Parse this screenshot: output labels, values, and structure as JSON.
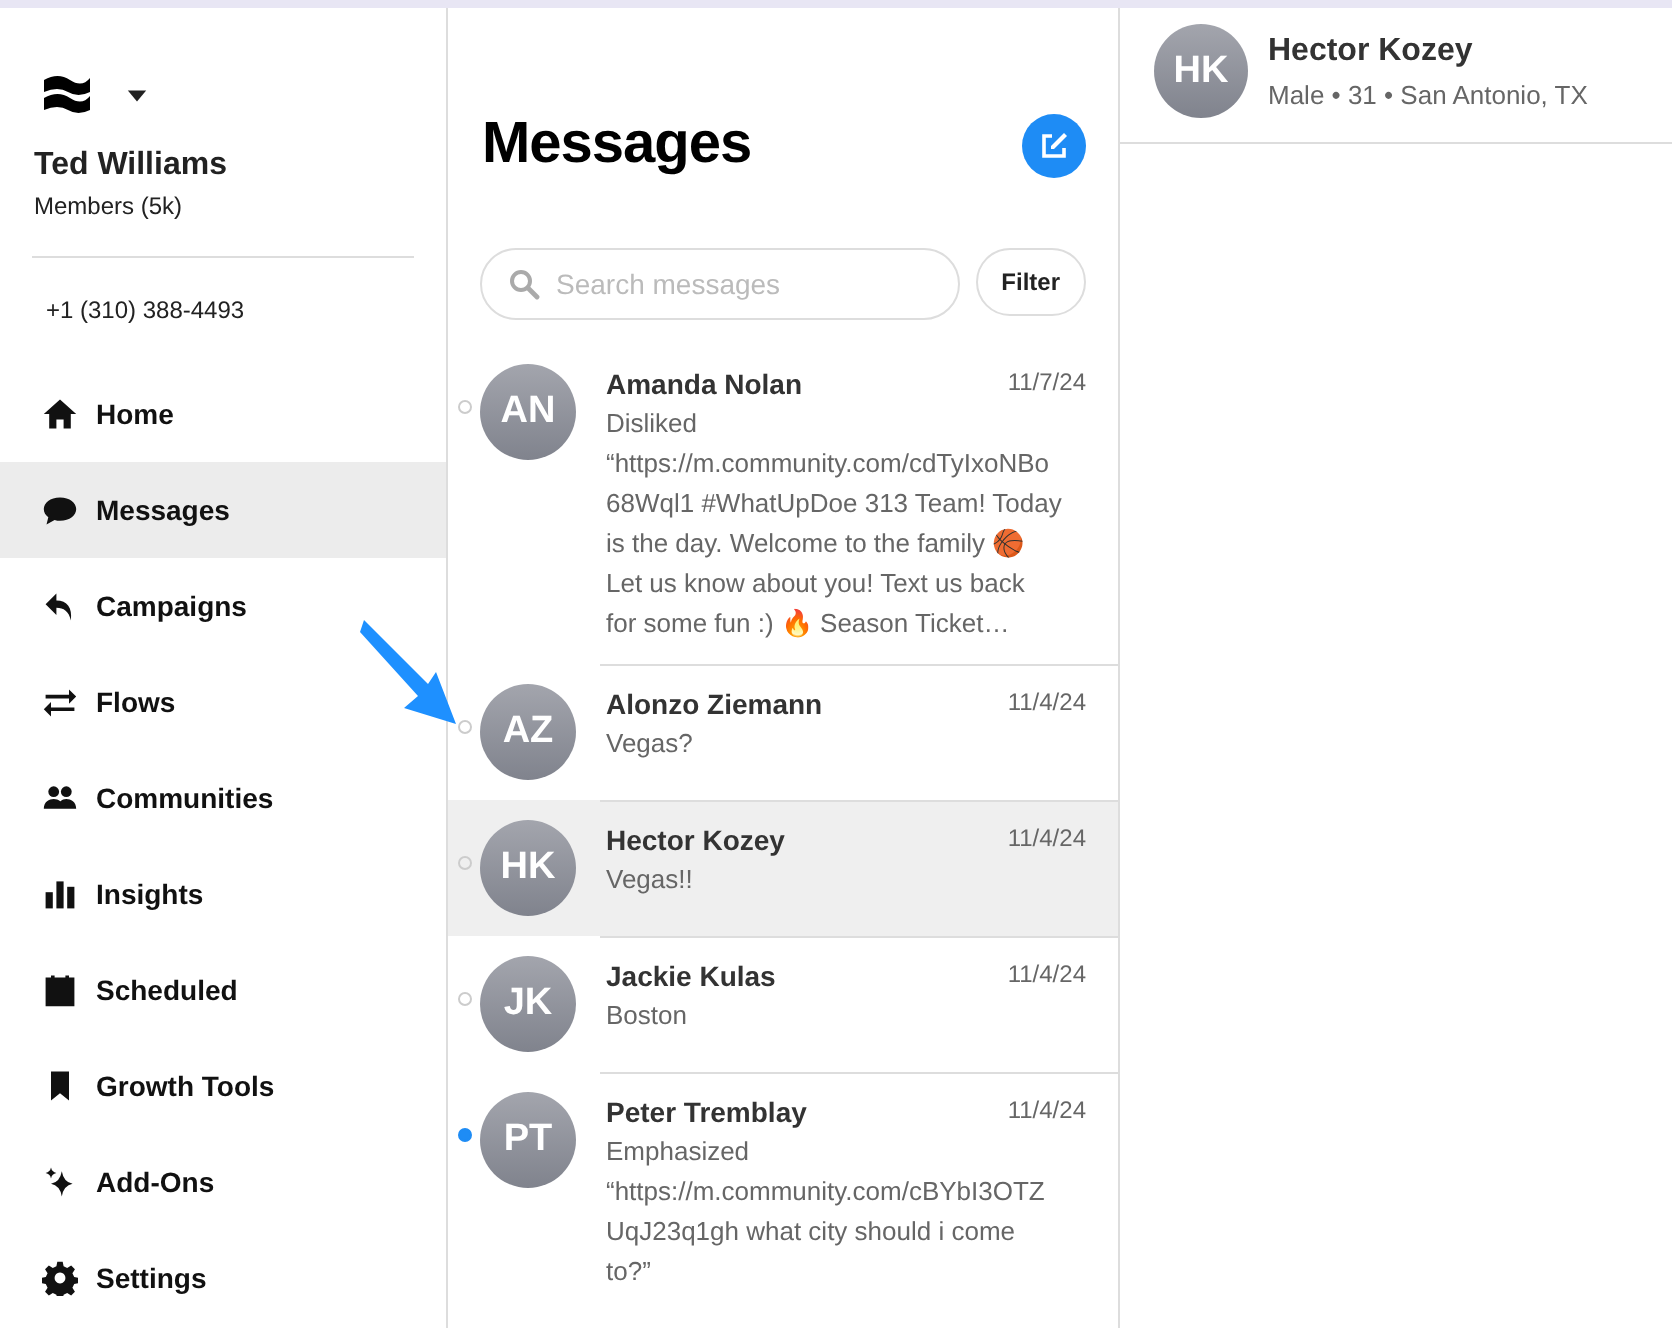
{
  "account": {
    "name": "Ted Williams",
    "members": "Members (5k)",
    "phone": "+1 (310) 388-4493"
  },
  "nav": [
    {
      "label": "Home",
      "selected": false
    },
    {
      "label": "Messages",
      "selected": true
    },
    {
      "label": "Campaigns",
      "selected": false
    },
    {
      "label": "Flows",
      "selected": false
    },
    {
      "label": "Communities",
      "selected": false
    },
    {
      "label": "Insights",
      "selected": false
    },
    {
      "label": "Scheduled",
      "selected": false
    },
    {
      "label": "Growth Tools",
      "selected": false
    },
    {
      "label": "Add-Ons",
      "selected": false
    },
    {
      "label": "Settings",
      "selected": false
    }
  ],
  "messages_panel": {
    "title": "Messages",
    "search": {
      "placeholder": "Search messages"
    },
    "filter": "Filter",
    "conversations": [
      {
        "initials": "AN",
        "name": "Amanda Nolan",
        "date": "11/7/24",
        "preview": "Disliked “https://m.community.com/cdTyIxoNBo68Wql1 #WhatUpDoe 313 Team! Today is the day. Welcome to the family 🏀 Let us know about you! Text us back for some fun :) 🔥 Season Ticket…",
        "unread": false,
        "selected": false
      },
      {
        "initials": "AZ",
        "name": "Alonzo Ziemann",
        "date": "11/4/24",
        "preview": "Vegas?",
        "unread": false,
        "selected": false
      },
      {
        "initials": "HK",
        "name": "Hector Kozey",
        "date": "11/4/24",
        "preview": "Vegas!!",
        "unread": false,
        "selected": true
      },
      {
        "initials": "JK",
        "name": "Jackie Kulas",
        "date": "11/4/24",
        "preview": "Boston",
        "unread": false,
        "selected": false
      },
      {
        "initials": "PT",
        "name": "Peter Tremblay",
        "date": "11/4/24",
        "preview": "Emphasized “https://m.community.com/cBYbI3OTZUqJ23q1gh what city should i come to?”",
        "unread": true,
        "selected": false
      }
    ]
  },
  "contact": {
    "initials": "HK",
    "name": "Hector Kozey",
    "details": "Male • 31 • San Antonio, TX"
  }
}
